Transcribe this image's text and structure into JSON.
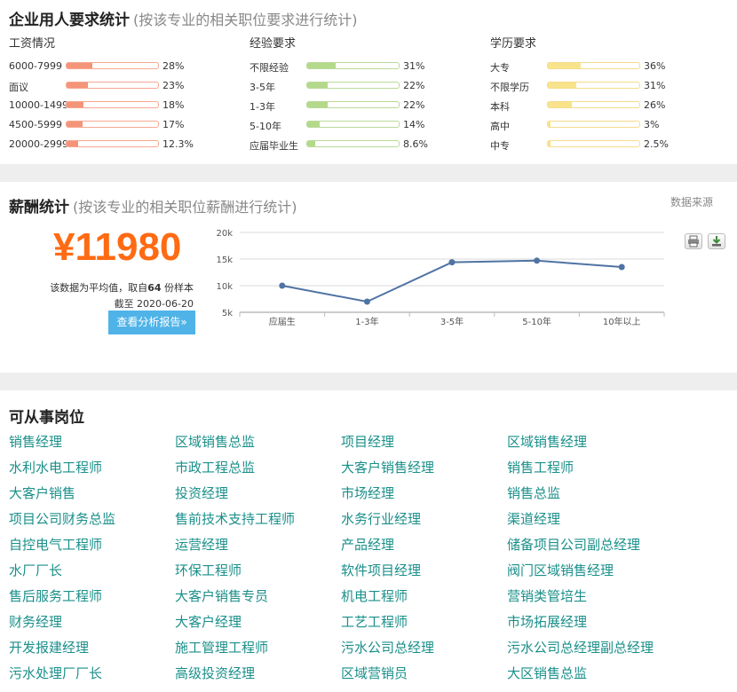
{
  "requirements": {
    "title": "企业用人要求统计",
    "subtitle": "(按该专业的相关职位要求进行统计)",
    "salary": {
      "heading": "工资情况",
      "items": [
        {
          "label": "6000-7999",
          "pct": "28%",
          "value": 28
        },
        {
          "label": "面议",
          "pct": "23%",
          "value": 23
        },
        {
          "label": "10000-1499",
          "pct": "18%",
          "value": 18
        },
        {
          "label": "4500-5999",
          "pct": "17%",
          "value": 17
        },
        {
          "label": "20000-2999",
          "pct": "12.3%",
          "value": 12.3
        }
      ]
    },
    "experience": {
      "heading": "经验要求",
      "items": [
        {
          "label": "不限经验",
          "pct": "31%",
          "value": 31
        },
        {
          "label": "3-5年",
          "pct": "22%",
          "value": 22
        },
        {
          "label": "1-3年",
          "pct": "22%",
          "value": 22
        },
        {
          "label": "5-10年",
          "pct": "14%",
          "value": 14
        },
        {
          "label": "应届毕业生",
          "pct": "8.6%",
          "value": 8.6
        }
      ]
    },
    "education": {
      "heading": "学历要求",
      "items": [
        {
          "label": "大专",
          "pct": "36%",
          "value": 36
        },
        {
          "label": "不限学历",
          "pct": "31%",
          "value": 31
        },
        {
          "label": "本科",
          "pct": "26%",
          "value": 26
        },
        {
          "label": "高中",
          "pct": "3%",
          "value": 3
        },
        {
          "label": "中专",
          "pct": "2.5%",
          "value": 2.5
        }
      ]
    }
  },
  "colors": {
    "salary_bar": "#f49478",
    "salary_border": "#f6a891",
    "exp_bar": "#b4d98a",
    "exp_border": "#b9d99a",
    "edu_bar": "#f8e38a",
    "edu_border": "#f5db8c",
    "accent": "#ff6a13",
    "button": "#4fb3e8",
    "link": "#1a8f8a",
    "line": "#4f73a3"
  },
  "salary_stats": {
    "title": "薪酬统计",
    "subtitle": "(按该专业的相关职位薪酬进行统计)",
    "amount": "¥11980",
    "note_prefix": "该数据为平均值，取自",
    "sample_count": "64",
    "note_suffix": "份样本",
    "date_line": "截至 2020-06-20",
    "report_button": "查看分析报告»",
    "source": "数据来源",
    "print_icon": "printer-icon",
    "download_icon": "download-icon"
  },
  "chart_data": {
    "type": "line",
    "categories": [
      "应届生",
      "1-3年",
      "3-5年",
      "5-10年",
      "10年以上"
    ],
    "values": [
      10000,
      7000,
      14400,
      14700,
      13500
    ],
    "y_ticks": [
      "5k",
      "10k",
      "15k",
      "20k"
    ],
    "ylim": [
      5000,
      20000
    ],
    "grid": true
  },
  "jobs": {
    "title": "可从事岗位",
    "items": [
      "销售经理",
      "区域销售总监",
      "项目经理",
      "区域销售经理",
      "水利水电工程师",
      "市政工程总监",
      "大客户销售经理",
      "销售工程师",
      "大客户销售",
      "投资经理",
      "市场经理",
      "销售总监",
      "项目公司财务总监",
      "售前技术支持工程师",
      "水务行业经理",
      "渠道经理",
      "自控电气工程师",
      "运营经理",
      "产品经理",
      "储备项目公司副总经理",
      "水厂厂长",
      "环保工程师",
      "软件项目经理",
      "阀门区域销售经理",
      "售后服务工程师",
      "大客户销售专员",
      "机电工程师",
      "营销类管培生",
      "财务经理",
      "大客户经理",
      "工艺工程师",
      "市场拓展经理",
      "开发报建经理",
      "施工管理工程师",
      "污水公司总经理",
      "污水公司总经理副总经理",
      "污水处理厂厂长",
      "高级投资经理",
      "区域营销员",
      "大区销售总监"
    ]
  }
}
